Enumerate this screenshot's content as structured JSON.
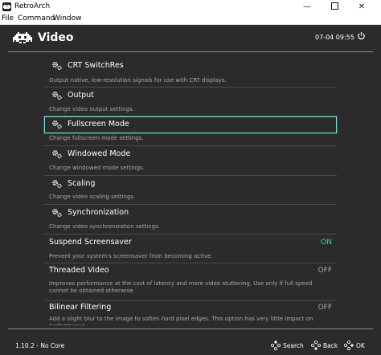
{
  "window": {
    "title": "RetroArch",
    "controls": {
      "minimize": "—",
      "close": "✕"
    }
  },
  "menubar": [
    "File",
    "Command",
    "Window"
  ],
  "header": {
    "title": "Video",
    "clock": "07-04 09:55"
  },
  "items": [
    {
      "label": "CRT SwitchRes",
      "desc": "Output native, low-resolution signals for use with CRT displays.",
      "icon": "gear-icon"
    },
    {
      "label": "Output",
      "desc": "Change video output settings.",
      "icon": "gear-icon"
    },
    {
      "label": "Fullscreen Mode",
      "desc": "Change fullscreen mode settings.",
      "icon": "gear-icon",
      "selected": true
    },
    {
      "label": "Windowed Mode",
      "desc": "Change windowed mode settings.",
      "icon": "gear-icon"
    },
    {
      "label": "Scaling",
      "desc": "Change video scaling settings.",
      "icon": "gear-icon"
    },
    {
      "label": "Synchronization",
      "desc": "Change video synchronization settings.",
      "icon": "gear-icon"
    },
    {
      "label": "Suspend Screensaver",
      "desc": "Prevent your system's screensaver from becoming active.",
      "value": "ON"
    },
    {
      "label": "Threaded Video",
      "desc": "Improves performance at the cost of latency and more video stuttering. Use only if full speed cannot be obtained otherwise.",
      "value": "OFF"
    },
    {
      "label": "Bilinear Filtering",
      "desc": "Add a slight blur to the image to soften hard pixel edges. This option has very little impact on performance.",
      "value": "OFF"
    }
  ],
  "footer": {
    "version": "1.10.2 - No Core",
    "search": "Search",
    "back": "Back",
    "ok": "OK"
  },
  "colors": {
    "accent_on": "#3fd6a0",
    "selection_border": "#7ad3d9",
    "background": "#2b2b2b"
  }
}
